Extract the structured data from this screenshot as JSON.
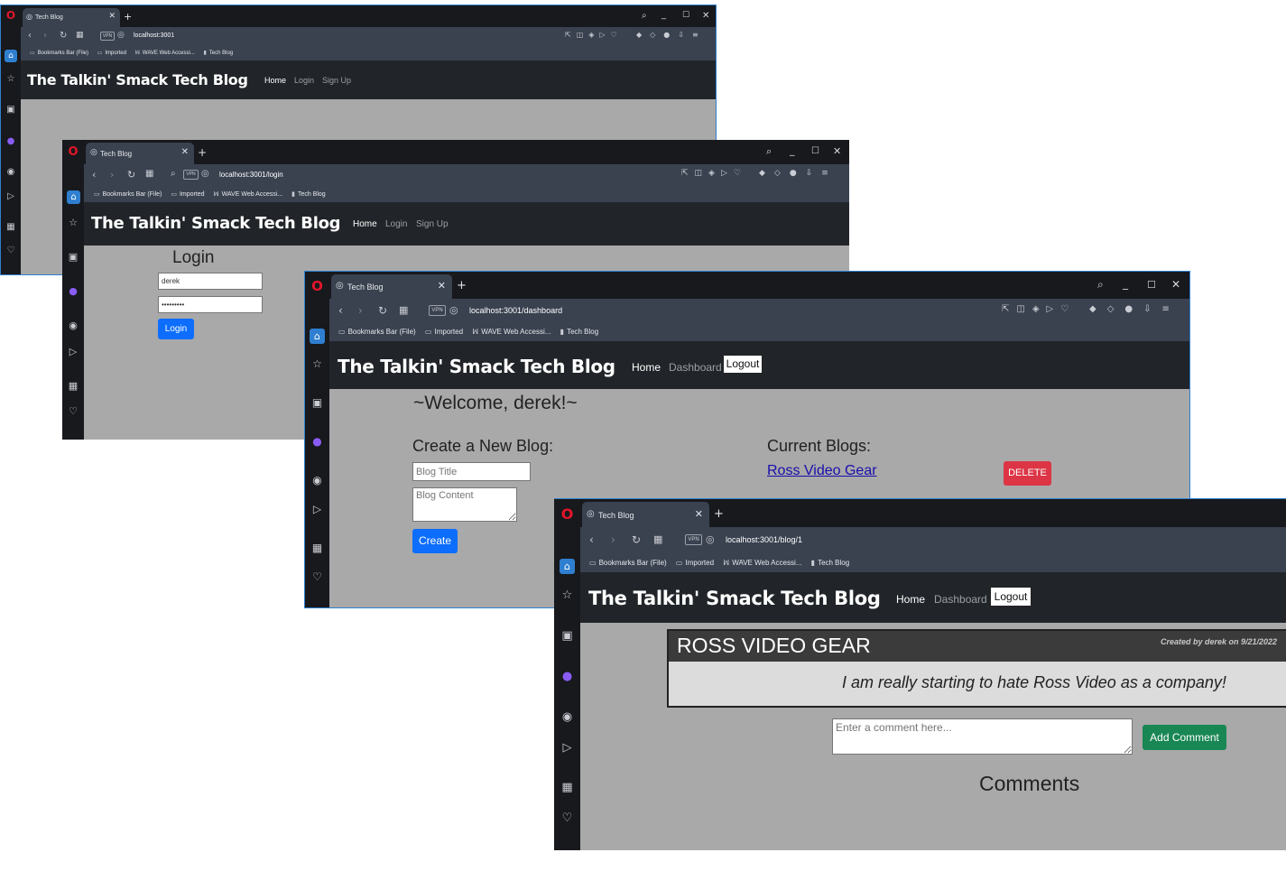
{
  "browser": {
    "tab_title": "Tech Blog",
    "bookmarks": [
      "Bookmarks Bar (File)",
      "Imported",
      "WAVE Web Accessi...",
      "Tech Blog"
    ],
    "vpn_label": "VPN"
  },
  "site": {
    "brand": "The Talkin' Smack Tech Blog",
    "nav": {
      "home": "Home",
      "login": "Login",
      "signup": "Sign Up",
      "dashboard": "Dashboard",
      "logout": "Logout"
    }
  },
  "window_home": {
    "url": "localhost:3001"
  },
  "window_login": {
    "url": "localhost:3001/login",
    "heading": "Login",
    "username_value": "derek",
    "password_value": "•••••••••",
    "submit_label": "Login"
  },
  "window_dashboard": {
    "url": "localhost:3001/dashboard",
    "welcome": "~Welcome, derek!~",
    "create_heading": "Create a New Blog:",
    "title_placeholder": "Blog Title",
    "content_placeholder": "Blog Content",
    "create_label": "Create",
    "current_heading": "Current Blogs:",
    "blogs": [
      {
        "title": "Ross Video Gear",
        "delete_label": "DELETE"
      }
    ]
  },
  "window_blog": {
    "url": "localhost:3001/blog/1",
    "post_title": "ROSS VIDEO GEAR",
    "post_meta": "Created by derek on 9/21/2022",
    "post_content": "I am really starting to hate Ross Video as a company!",
    "comment_placeholder": "Enter a comment here...",
    "add_comment_label": "Add Comment",
    "comments_heading": "Comments"
  }
}
